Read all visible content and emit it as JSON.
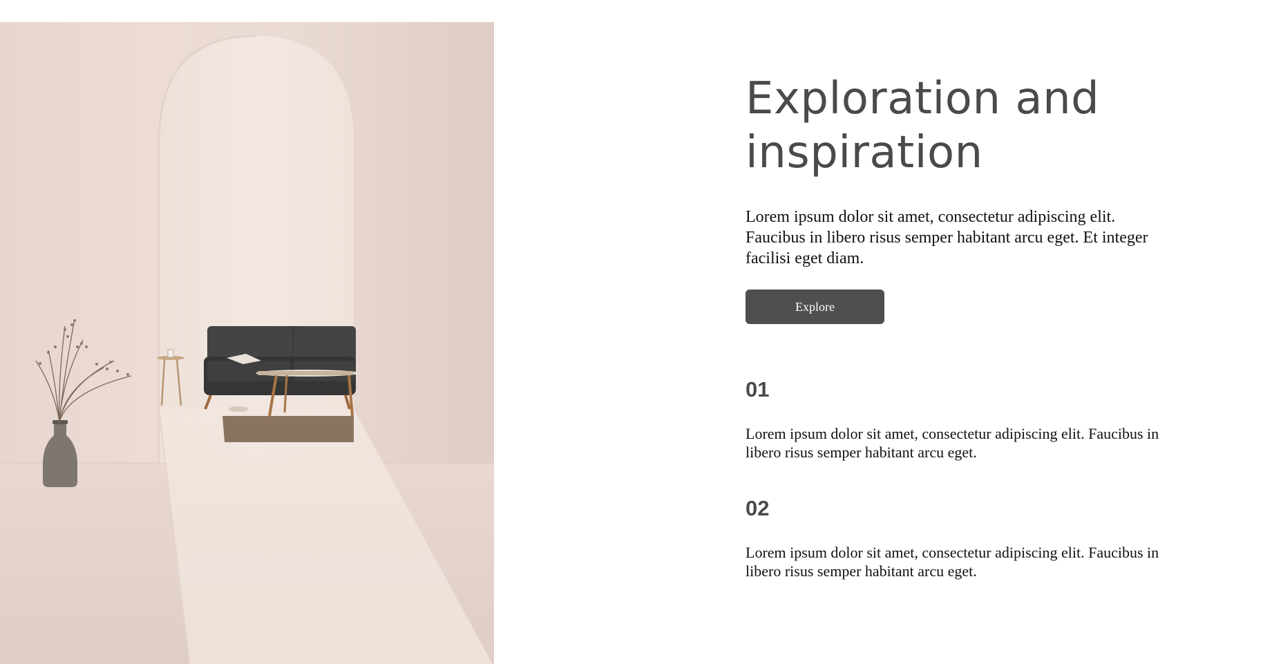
{
  "hero": {
    "image_alt": "Minimal interior with arched doorway, dark sofa, coffee table and vase with dried grass"
  },
  "content": {
    "headline_line1": "Exploration and",
    "headline_line2": "inspiration",
    "intro": "Lorem ipsum dolor sit amet, consectetur adipiscing elit. Faucibus in libero risus semper habitant arcu eget. Et integer facilisi eget diam.",
    "button_label": "Explore"
  },
  "features": [
    {
      "number": "01",
      "text": "Lorem ipsum dolor sit amet, consectetur adipiscing elit. Faucibus in libero risus semper habitant arcu eget."
    },
    {
      "number": "02",
      "text": "Lorem ipsum dolor sit amet, consectetur adipiscing elit. Faucibus in libero risus semper habitant arcu eget."
    }
  ],
  "colors": {
    "heading": "#4a4a4a",
    "button_bg": "#4f4f4f",
    "button_text": "#ffffff",
    "wall": "#e9dad3",
    "sofa": "#3a3a3a"
  }
}
